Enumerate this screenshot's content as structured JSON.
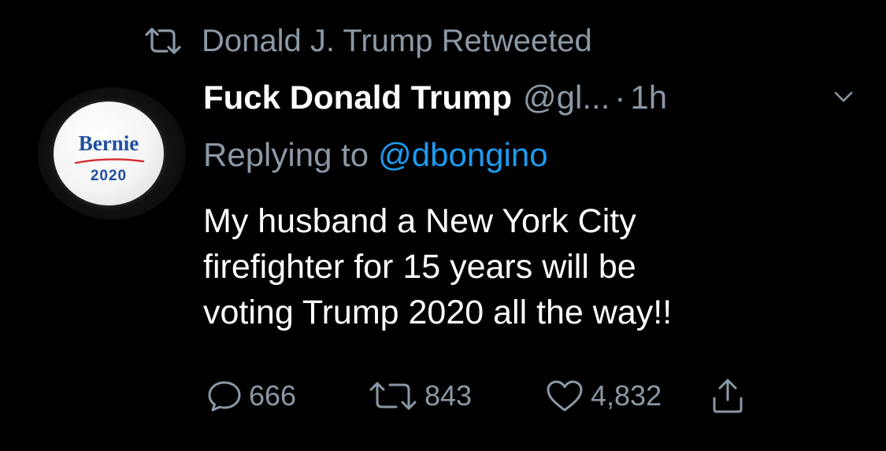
{
  "retweet_context": {
    "text": "Donald J. Trump Retweeted",
    "icon": "retweet-icon"
  },
  "author": {
    "display_name": "Fuck Donald Trump",
    "handle": "@gl...",
    "separator": "·",
    "time": "1h",
    "avatar": {
      "word": "Bernie",
      "year": "2020",
      "brand_blue": "#1f4e9c",
      "swoosh_red": "#d62b34"
    }
  },
  "reply": {
    "prefix": "Replying to",
    "handle": "@dbongino"
  },
  "tweet": {
    "lines": [
      "My husband a New York City",
      "firefighter for 15 years will be",
      "voting Trump 2020 all the way!!"
    ]
  },
  "actions": {
    "reply_count": "666",
    "retweet_count": "843",
    "like_count": "4,832",
    "icons": [
      "reply-icon",
      "retweet-icon",
      "like-icon",
      "share-icon"
    ]
  },
  "colors": {
    "background": "#000000",
    "primary_text": "#ffffff",
    "secondary_text": "#8b98a5",
    "link": "#1d9bf0"
  }
}
